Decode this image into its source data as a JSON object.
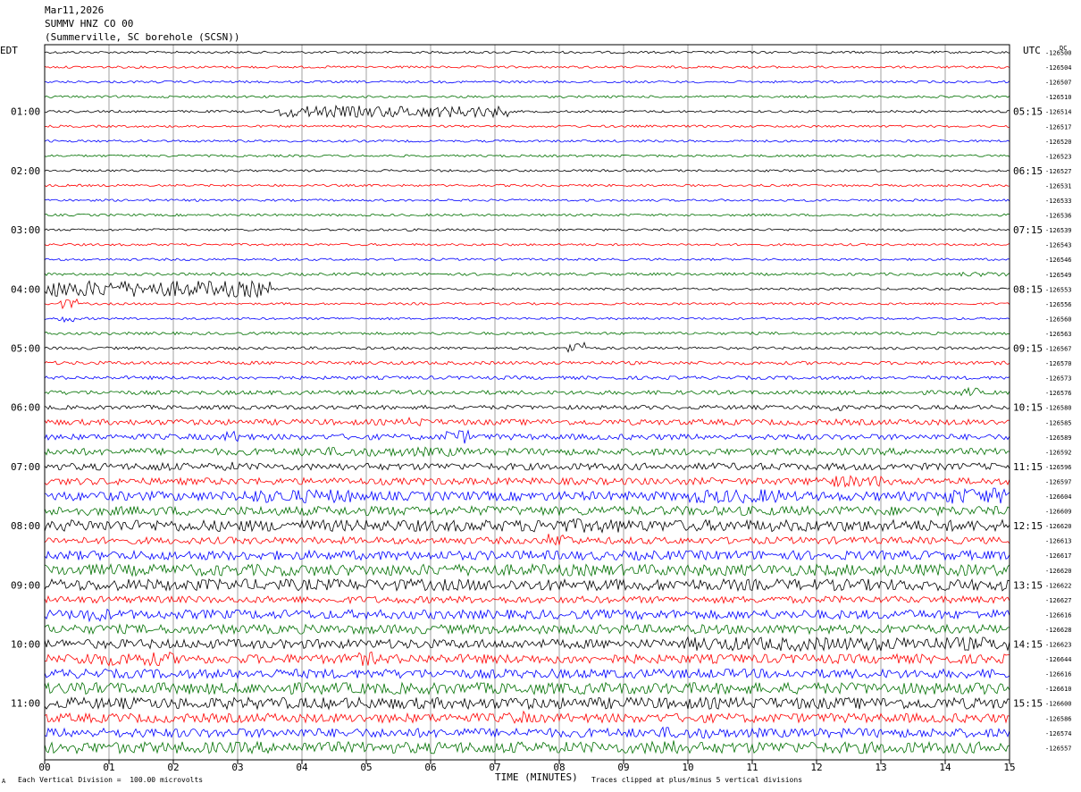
{
  "header": {
    "line1": "Mar11,2026",
    "line2": "SUMMV HNZ CO 00",
    "line3": "(Summerville, SC borehole (SCSN))"
  },
  "corner": {
    "left_tz": "EDT",
    "right_tz": "UTC",
    "dc": "DC"
  },
  "footer": {
    "left_note": "Each Vertical Division =  100.00 microvolts",
    "right_note": "Traces clipped at plus/minus 5 vertical divisions",
    "mark": "A"
  },
  "colors": {
    "trace_cycle": [
      "#000000",
      "#ff0000",
      "#0000ff",
      "#007000"
    ],
    "grid": "#a0a0a0",
    "background": "#ffffff"
  },
  "chart_data": {
    "type": "line",
    "chart_kind": "helicorder seismogram",
    "xlabel": "TIME (MINUTES)",
    "xlim": [
      0,
      15
    ],
    "x_ticks": [
      "00",
      "01",
      "02",
      "03",
      "04",
      "05",
      "06",
      "07",
      "08",
      "09",
      "10",
      "11",
      "12",
      "13",
      "14",
      "15"
    ],
    "rows_per_hour": 4,
    "minutes_per_row": 15,
    "left_hour_labels": [
      "01:00",
      "02:00",
      "03:00",
      "04:00",
      "05:00",
      "06:00",
      "07:00",
      "08:00",
      "09:00",
      "10:00",
      "11:00"
    ],
    "right_hour_labels": [
      "05:15",
      "06:15",
      "07:15",
      "08:15",
      "09:15",
      "10:15",
      "11:15",
      "12:15",
      "13:15",
      "14:15",
      "15:15"
    ],
    "row_dc_offsets": [
      -126500,
      -126504,
      -126507,
      -126510,
      -126514,
      -126517,
      -126520,
      -126523,
      -126527,
      -126531,
      -126533,
      -126536,
      -126539,
      -126543,
      -126546,
      -126549,
      -126553,
      -126556,
      -126560,
      -126563,
      -126567,
      -126570,
      -126573,
      -126576,
      -126580,
      -126585,
      -126589,
      -126592,
      -126596,
      -126597,
      -126604,
      -126609,
      -126620,
      -126613,
      -126617,
      -126620,
      -126622,
      -126627,
      -126616,
      -126628,
      -126623,
      -126644,
      -126616,
      -126610,
      -126600,
      -126586,
      -126574,
      -126557
    ],
    "row_activity": [
      [
        [
          0,
          15,
          1
        ]
      ],
      [
        [
          0,
          15,
          1
        ]
      ],
      [
        [
          0,
          15,
          1
        ]
      ],
      [
        [
          0,
          15,
          1
        ]
      ],
      [
        [
          0,
          15,
          1
        ],
        [
          3.6,
          7.2,
          5
        ]
      ],
      [
        [
          0,
          15,
          1
        ]
      ],
      [
        [
          0,
          15,
          1
        ]
      ],
      [
        [
          0,
          15,
          1
        ]
      ],
      [
        [
          0,
          15,
          1
        ]
      ],
      [
        [
          0,
          15,
          1
        ]
      ],
      [
        [
          0,
          15,
          1
        ]
      ],
      [
        [
          0,
          15,
          1
        ]
      ],
      [
        [
          0,
          15,
          1
        ]
      ],
      [
        [
          0,
          15,
          1
        ]
      ],
      [
        [
          0,
          15,
          1
        ]
      ],
      [
        [
          0,
          15,
          1.2
        ],
        [
          14.2,
          15,
          2
        ]
      ],
      [
        [
          0,
          15,
          1
        ],
        [
          0,
          3.5,
          7
        ]
      ],
      [
        [
          0,
          15,
          1
        ],
        [
          0.2,
          0.5,
          4
        ]
      ],
      [
        [
          0,
          15,
          1
        ],
        [
          0.2,
          0.5,
          3
        ]
      ],
      [
        [
          0,
          15,
          1.2
        ]
      ],
      [
        [
          0,
          15,
          1.2
        ],
        [
          8.1,
          8.4,
          5
        ]
      ],
      [
        [
          0,
          15,
          1.5
        ]
      ],
      [
        [
          0,
          15,
          1.5
        ]
      ],
      [
        [
          0,
          15,
          1.8
        ],
        [
          14.2,
          14.5,
          4
        ]
      ],
      [
        [
          0,
          15,
          1.8
        ],
        [
          10.7,
          11,
          2
        ],
        [
          12.2,
          12.4,
          4
        ]
      ],
      [
        [
          0,
          15,
          2.5
        ],
        [
          5.6,
          5.9,
          4
        ]
      ],
      [
        [
          0,
          15,
          2.5
        ],
        [
          2.8,
          3.2,
          5
        ],
        [
          6.2,
          6.6,
          6
        ]
      ],
      [
        [
          0,
          15,
          3
        ],
        [
          4,
          6.5,
          4
        ]
      ],
      [
        [
          0,
          15,
          3
        ],
        [
          1.6,
          2,
          4
        ],
        [
          2.8,
          3,
          4
        ]
      ],
      [
        [
          0,
          15,
          3
        ],
        [
          12,
          13,
          5
        ]
      ],
      [
        [
          0,
          15,
          4
        ],
        [
          3,
          4.8,
          6
        ],
        [
          10,
          11.5,
          6
        ],
        [
          14,
          15,
          7
        ]
      ],
      [
        [
          0,
          15,
          4
        ]
      ],
      [
        [
          0,
          15,
          5
        ],
        [
          7.5,
          9,
          6
        ]
      ],
      [
        [
          0,
          15,
          3
        ],
        [
          7.8,
          8.2,
          6
        ]
      ],
      [
        [
          0,
          15,
          4
        ]
      ],
      [
        [
          0,
          15,
          5
        ]
      ],
      [
        [
          0,
          15,
          5
        ]
      ],
      [
        [
          0,
          15,
          3
        ]
      ],
      [
        [
          0,
          15,
          4
        ],
        [
          0.5,
          1,
          6
        ]
      ],
      [
        [
          0,
          15,
          4
        ]
      ],
      [
        [
          0,
          15,
          4
        ],
        [
          10,
          15,
          6
        ]
      ],
      [
        [
          0,
          15,
          4
        ],
        [
          0.5,
          2,
          6
        ],
        [
          4.8,
          5.2,
          6
        ]
      ],
      [
        [
          0,
          15,
          4
        ]
      ],
      [
        [
          0,
          15,
          5
        ]
      ],
      [
        [
          0,
          15,
          5
        ]
      ],
      [
        [
          0,
          15,
          4
        ],
        [
          7.2,
          7.5,
          6
        ]
      ],
      [
        [
          0,
          15,
          4
        ],
        [
          9.5,
          10.5,
          5
        ]
      ],
      [
        [
          0,
          15,
          5
        ],
        [
          9.4,
          9.8,
          8
        ]
      ]
    ]
  }
}
